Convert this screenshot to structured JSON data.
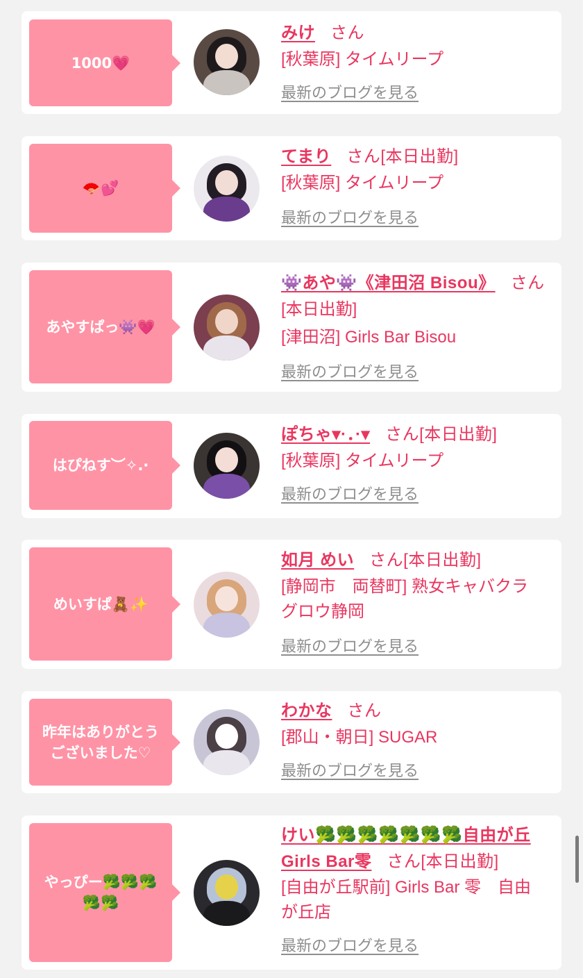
{
  "blog_link_label": "最新のブログを見る",
  "san_label": "さん",
  "colors": {
    "background": "#f2f2f2",
    "card": "#ffffff",
    "bubble": "#ff93a6",
    "accent": "#e8365f",
    "muted": "#8e8e8e"
  },
  "entries": [
    {
      "bubble_text": "1000💗",
      "name": "みけ",
      "status": "",
      "shop_lines": [
        "[秋葉原] タイムリープ"
      ]
    },
    {
      "bubble_text": "🪭💕",
      "name": "てまり",
      "status": "[本日出勤]",
      "shop_lines": [
        "[秋葉原] タイムリープ"
      ]
    },
    {
      "bubble_text": "あやすぱっ👾💗",
      "name": "👾あや👾《津田沼 Bisou》",
      "status": "[本日出勤]",
      "shop_lines": [
        "[津田沼] Girls Bar Bisou"
      ]
    },
    {
      "bubble_text": "はぴねす︶✧.·",
      "name": "ぽちゃ▾·．·▾",
      "status": "[本日出勤]",
      "shop_lines": [
        "[秋葉原] タイムリープ"
      ]
    },
    {
      "bubble_text": "めいすぱ🧸✨",
      "name": "如月 めい",
      "status": "[本日出勤]",
      "shop_lines": [
        "[静岡市　両替町] 熟女キャバクラ",
        "グロウ静岡"
      ]
    },
    {
      "bubble_text": "昨年はありがとうございました♡",
      "name": "わかな",
      "status": "",
      "shop_lines": [
        "[郡山・朝日] SUGAR"
      ]
    },
    {
      "bubble_text": "やっぴー🥦🥦🥦🥦🥦",
      "name": "けい🥦🥦🥦🥦🥦🥦🥦自由が丘Girls Bar零",
      "status": "[本日出勤]",
      "shop_lines": [
        "[自由が丘駅前] Girls Bar 零　自由",
        "が丘店"
      ]
    }
  ]
}
